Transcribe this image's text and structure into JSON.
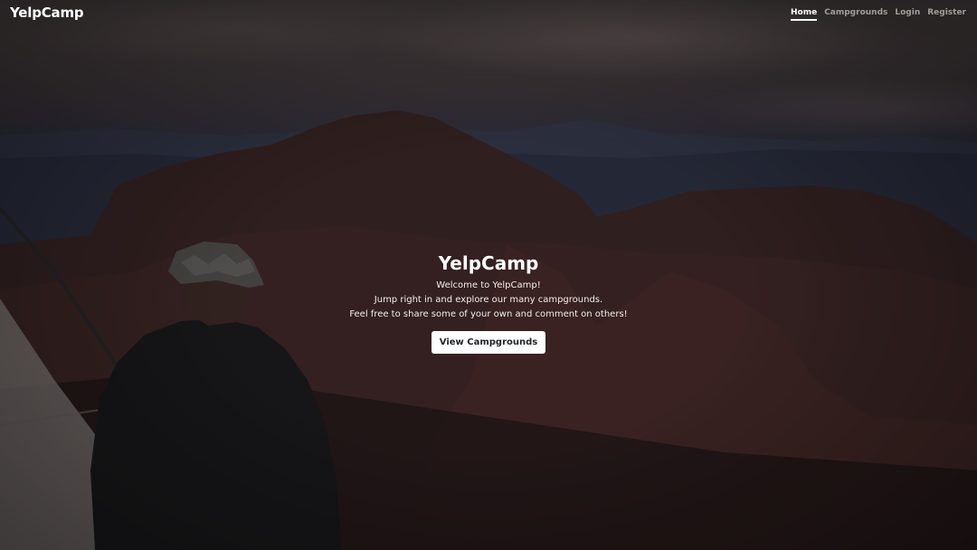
{
  "navbar": {
    "brand": "YelpCamp",
    "links": [
      {
        "label": "Home",
        "active": true
      },
      {
        "label": "Campgrounds",
        "active": false
      },
      {
        "label": "Login",
        "active": false
      },
      {
        "label": "Register",
        "active": false
      }
    ]
  },
  "hero": {
    "title": "YelpCamp",
    "lines": [
      "Welcome to YelpCamp!",
      "Jump right in and explore our many campgrounds.",
      "Feel free to share some of your own and comment on others!"
    ],
    "cta_label": "View Campgrounds"
  },
  "colors": {
    "nav_active": "#ffffff",
    "nav_inactive": "#a29c9a",
    "button_bg": "#ffffff",
    "button_text": "#212529"
  }
}
